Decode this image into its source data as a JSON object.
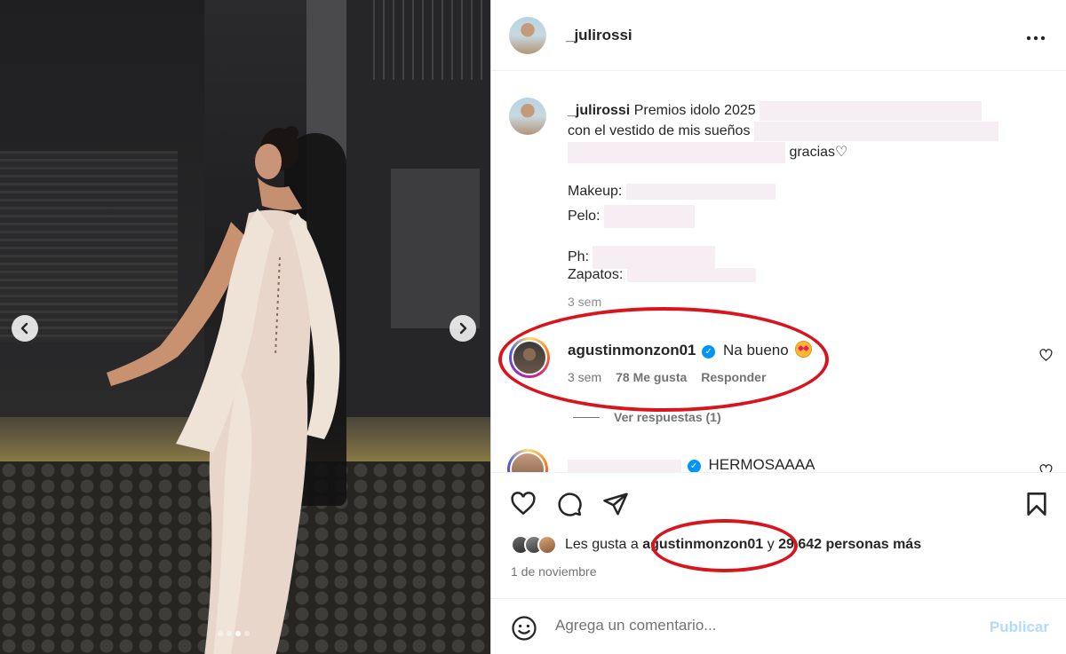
{
  "post": {
    "username": "_julirossi",
    "more_icon": "more-horizontal-icon",
    "carousel": {
      "prev_icon": "chevron-left-icon",
      "next_icon": "chevron-right-icon",
      "slide_count": 4,
      "active_slide": 3
    }
  },
  "caption": {
    "username": "_julirossi",
    "line1": "Premios idolo 2025",
    "line2": "con el vestido de mis sueños",
    "line3": "gracias♡",
    "makeup_label": "Makeup:",
    "pelo_label": "Pelo:",
    "ph_label": "Ph:",
    "zapatos_label": "Zapatos:",
    "time": "3 sem"
  },
  "comments": [
    {
      "username": "agustinmonzon01",
      "verified": true,
      "text": "Na bueno",
      "emoji": "heart-eyes-emoji",
      "time": "3 sem",
      "likes": "78 Me gusta",
      "reply_label": "Responder",
      "view_replies": "Ver respuestas (1)"
    },
    {
      "username": "",
      "verified": true,
      "text": "HERMOSAAAA"
    }
  ],
  "actions": {
    "like_icon": "heart-icon",
    "comment_icon": "comment-icon",
    "share_icon": "send-icon",
    "save_icon": "bookmark-icon",
    "likes_prefix": "Les gusta a",
    "likes_user": "agustinmonzon01",
    "likes_suffix_conj": "y",
    "likes_count": "29.642 personas más",
    "date": "1 de noviembre"
  },
  "comment_bar": {
    "emoji_icon": "smiley-icon",
    "placeholder": "Agrega un comentario...",
    "publish_label": "Publicar"
  },
  "colors": {
    "annotation_red": "#d8151c",
    "verified_blue": "#0095f6",
    "publish_disabled": "#b3dbff"
  }
}
